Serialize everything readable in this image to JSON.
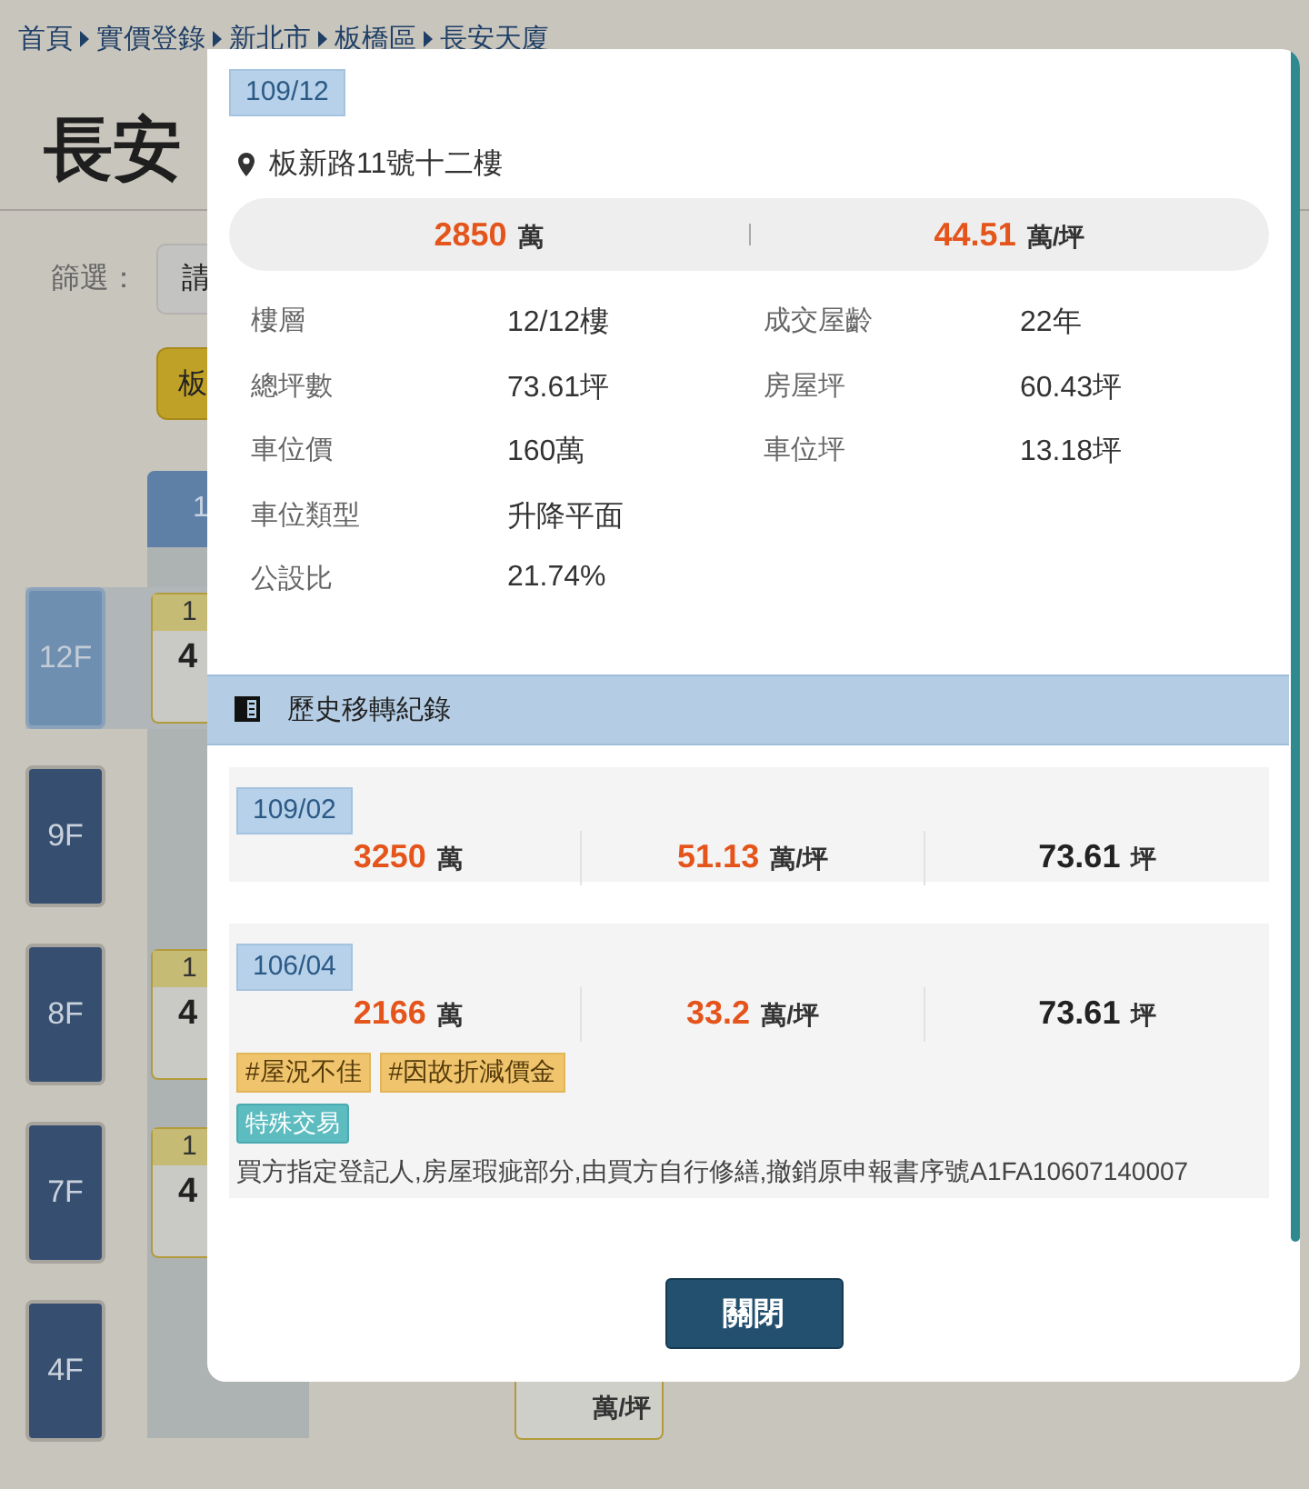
{
  "breadcrumb": [
    {
      "label": "首頁"
    },
    {
      "label": "實價登錄"
    },
    {
      "label": "新北市"
    },
    {
      "label": "板橋區"
    },
    {
      "label": "長安天廈"
    }
  ],
  "page_title": "長安",
  "filter": {
    "label": "篩選：",
    "select_value": "請"
  },
  "building_button": "板",
  "column_tab": "1",
  "floors": [
    {
      "label": "12F",
      "selected": true,
      "cards": [
        {
          "kind": "summary",
          "line_1": "1",
          "line_2": "4"
        }
      ]
    },
    {
      "label": "9F",
      "selected": false
    },
    {
      "label": "8F",
      "selected": false,
      "cards": [
        {
          "kind": "summary",
          "line_1": "1",
          "line_2": "4"
        }
      ]
    },
    {
      "label": "7F",
      "selected": false,
      "cards": [
        {
          "kind": "summary",
          "line_1": "1",
          "line_2": "4"
        }
      ]
    },
    {
      "label": "4F",
      "selected": false,
      "cards": [
        {
          "kind": "unit",
          "line_2": "萬/坪"
        }
      ]
    }
  ],
  "dialog": {
    "date": "109/12",
    "address": "板新路11號十二樓",
    "price": {
      "value": "2850",
      "unit": "萬"
    },
    "unit_price": {
      "value": "44.51",
      "unit": "萬/坪"
    },
    "detail_rows": [
      {
        "cells": [
          {
            "label": "樓層",
            "value": "12/12樓"
          },
          {
            "label": "成交屋齡",
            "value": "22年"
          }
        ]
      },
      {
        "cells": [
          {
            "label": "總坪數",
            "value": "73.61坪"
          },
          {
            "label": "房屋坪",
            "value": "60.43坪"
          }
        ]
      },
      {
        "cells": [
          {
            "label": "車位價",
            "value": "160萬"
          },
          {
            "label": "車位坪",
            "value": "13.18坪"
          }
        ]
      },
      {
        "cells": [
          {
            "label": "車位類型",
            "value": "升降平面"
          }
        ]
      },
      {
        "cells": [
          {
            "label": "公設比",
            "value": "21.74%"
          }
        ]
      }
    ],
    "history": {
      "title": "歷史移轉紀錄",
      "records": [
        {
          "date": "109/02",
          "price": "3250",
          "price_unit": "萬",
          "unit_price": "51.13",
          "unit_price_unit": "萬/坪",
          "area": "73.61",
          "area_unit": "坪"
        },
        {
          "date": "106/04",
          "price": "2166",
          "price_unit": "萬",
          "unit_price": "33.2",
          "unit_price_unit": "萬/坪",
          "area": "73.61",
          "area_unit": "坪",
          "tags": [
            "#屋況不佳",
            "#因故折減價金"
          ],
          "special": "特殊交易",
          "note": "買方指定登記人,房屋瑕疵部分,由買方自行修繕,撤銷原申報書序號A1FA10607140007"
        }
      ]
    },
    "close_button": "關閉"
  }
}
